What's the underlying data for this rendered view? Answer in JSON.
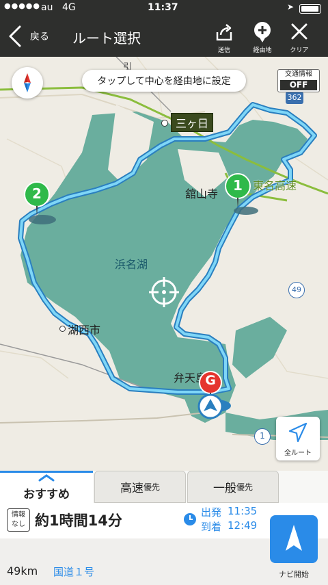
{
  "status_bar": {
    "signal": "●●●●●",
    "carrier": "au",
    "network": "4G",
    "time": "11:37",
    "location_icon": "location-arrow-icon",
    "battery_icon": "battery-icon"
  },
  "nav": {
    "back_label": "戻る",
    "title": "ルート選択",
    "actions": [
      {
        "label": "送信",
        "icon": "share-icon"
      },
      {
        "label": "経由地",
        "icon": "add-waypoint-icon"
      },
      {
        "label": "クリア",
        "icon": "close-icon"
      }
    ]
  },
  "map": {
    "tooltip": "タップして中心を経由地に設定",
    "traffic": {
      "title": "交通情報",
      "state": "OFF"
    },
    "labels": {
      "lake": "浜名湖",
      "city_west": "湖西市",
      "city_north": "三ヶ日",
      "kanzanji": "舘山寺",
      "bentenjima": "弁天島",
      "expressway": "東名高速",
      "route_362": "362",
      "route_49": "49",
      "route_1": "1",
      "road_top": "引"
    },
    "waypoints": [
      {
        "label": "1"
      },
      {
        "label": "2"
      }
    ],
    "goal_label": "G",
    "full_route_label": "全ルート"
  },
  "tabs": [
    {
      "label": "おすすめ",
      "suffix": "",
      "selected": true
    },
    {
      "label": "高速",
      "suffix": "優先",
      "selected": false
    },
    {
      "label": "一般",
      "suffix": "優先",
      "selected": false
    }
  ],
  "summary": {
    "info_badge": "情報\nなし",
    "duration": "約1時間14分",
    "depart_label": "出発",
    "depart_time": "11:35",
    "arrive_label": "到着",
    "arrive_time": "12:49",
    "distance": "49km",
    "road": "国道１号",
    "start_nav_label": "ナビ開始"
  },
  "colors": {
    "bar": "#2e2f2d",
    "lake": "#6aae9e",
    "route": "#5fc3f2",
    "waypoint": "#2fb94a",
    "goal": "#e5342e",
    "accent": "#2a8be8"
  }
}
